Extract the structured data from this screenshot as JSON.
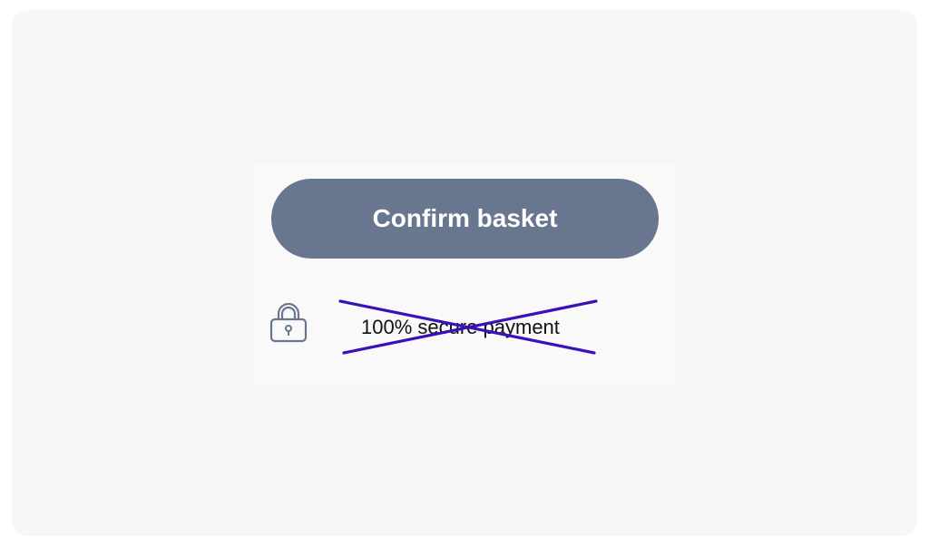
{
  "checkout": {
    "confirm_button_label": "Confirm basket",
    "secure_payment_text": "100% secure payment"
  },
  "icons": {
    "lock": "lock-icon"
  },
  "colors": {
    "button_background": "#68778f",
    "button_text": "#ffffff",
    "lock_icon": "#68778f",
    "cross_mark": "#3a11b8"
  }
}
